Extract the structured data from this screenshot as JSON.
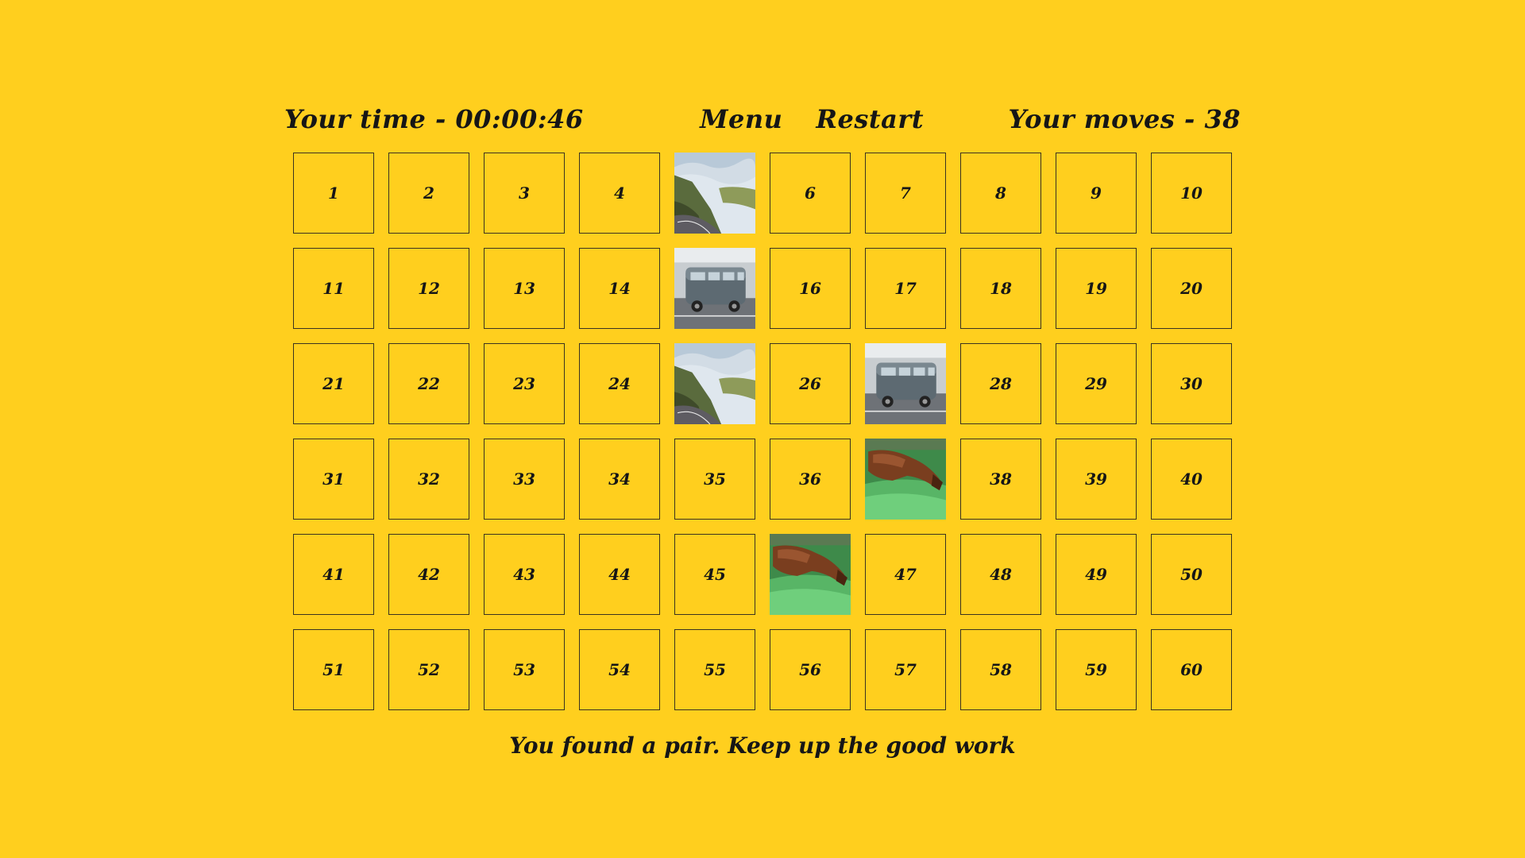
{
  "header": {
    "time_text": "Your time - 00:00:46",
    "menu_label": "Menu",
    "restart_label": "Restart",
    "moves_text": "Your moves - 38"
  },
  "board": {
    "cards": [
      {
        "label": "1",
        "image": null
      },
      {
        "label": "2",
        "image": null
      },
      {
        "label": "3",
        "image": null
      },
      {
        "label": "4",
        "image": null
      },
      {
        "label": "",
        "image": "mountain-road"
      },
      {
        "label": "6",
        "image": null
      },
      {
        "label": "7",
        "image": null
      },
      {
        "label": "8",
        "image": null
      },
      {
        "label": "9",
        "image": null
      },
      {
        "label": "10",
        "image": null
      },
      {
        "label": "11",
        "image": null
      },
      {
        "label": "12",
        "image": null
      },
      {
        "label": "13",
        "image": null
      },
      {
        "label": "14",
        "image": null
      },
      {
        "label": "",
        "image": "vw-van"
      },
      {
        "label": "16",
        "image": null
      },
      {
        "label": "17",
        "image": null
      },
      {
        "label": "18",
        "image": null
      },
      {
        "label": "19",
        "image": null
      },
      {
        "label": "20",
        "image": null
      },
      {
        "label": "21",
        "image": null
      },
      {
        "label": "22",
        "image": null
      },
      {
        "label": "23",
        "image": null
      },
      {
        "label": "24",
        "image": null
      },
      {
        "label": "",
        "image": "mountain-road"
      },
      {
        "label": "26",
        "image": null
      },
      {
        "label": "",
        "image": "vw-van"
      },
      {
        "label": "28",
        "image": null
      },
      {
        "label": "29",
        "image": null
      },
      {
        "label": "30",
        "image": null
      },
      {
        "label": "31",
        "image": null
      },
      {
        "label": "32",
        "image": null
      },
      {
        "label": "33",
        "image": null
      },
      {
        "label": "34",
        "image": null
      },
      {
        "label": "35",
        "image": null
      },
      {
        "label": "36",
        "image": null
      },
      {
        "label": "",
        "image": "horse-grazing"
      },
      {
        "label": "38",
        "image": null
      },
      {
        "label": "39",
        "image": null
      },
      {
        "label": "40",
        "image": null
      },
      {
        "label": "41",
        "image": null
      },
      {
        "label": "42",
        "image": null
      },
      {
        "label": "43",
        "image": null
      },
      {
        "label": "44",
        "image": null
      },
      {
        "label": "45",
        "image": null
      },
      {
        "label": "",
        "image": "horse-grazing"
      },
      {
        "label": "47",
        "image": null
      },
      {
        "label": "48",
        "image": null
      },
      {
        "label": "49",
        "image": null
      },
      {
        "label": "50",
        "image": null
      },
      {
        "label": "51",
        "image": null
      },
      {
        "label": "52",
        "image": null
      },
      {
        "label": "53",
        "image": null
      },
      {
        "label": "54",
        "image": null
      },
      {
        "label": "55",
        "image": null
      },
      {
        "label": "56",
        "image": null
      },
      {
        "label": "57",
        "image": null
      },
      {
        "label": "58",
        "image": null
      },
      {
        "label": "59",
        "image": null
      },
      {
        "label": "60",
        "image": null
      }
    ]
  },
  "status": {
    "message": "You found a pair. Keep up the good work"
  },
  "colors": {
    "background": "#ffcf1e",
    "text": "#161616",
    "card_border": "#3b3320"
  }
}
